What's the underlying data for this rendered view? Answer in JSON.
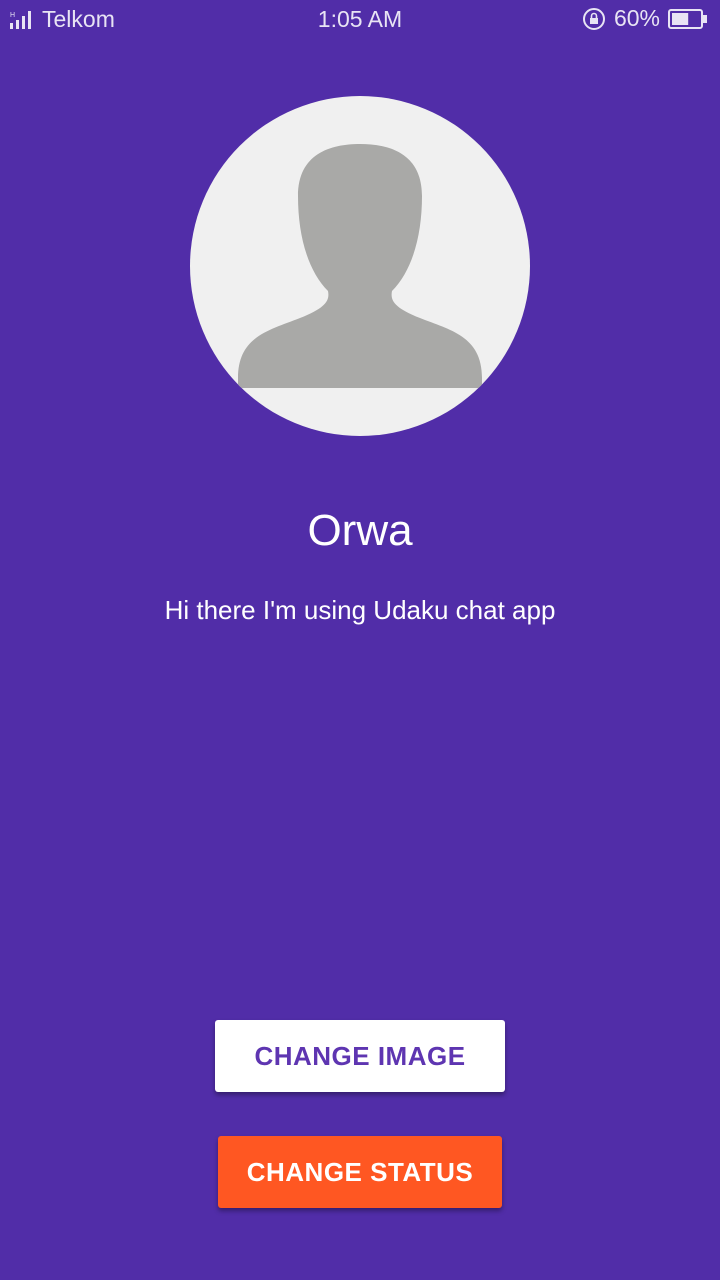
{
  "status_bar": {
    "carrier": "Telkom",
    "time": "1:05 AM",
    "battery_percent": "60%",
    "battery_level": 0.6
  },
  "profile": {
    "name": "Orwa",
    "status": "Hi there I'm using Udaku chat app",
    "avatar_icon": "default-user-silhouette"
  },
  "buttons": {
    "change_image": "CHANGE IMAGE",
    "change_status": "CHANGE STATUS"
  },
  "colors": {
    "background": "#512DA8",
    "accent": "#FF5722",
    "button_text_primary": "#5E35B1"
  }
}
